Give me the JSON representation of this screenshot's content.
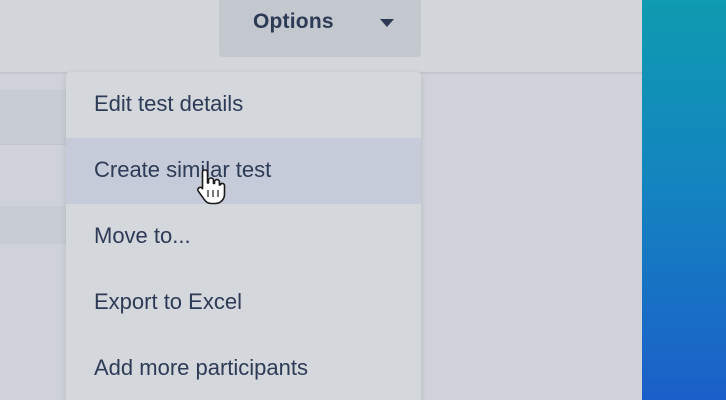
{
  "options_button": {
    "label": "Options",
    "icon": "caret-down-icon"
  },
  "menu": {
    "items": [
      {
        "label": "Edit test details",
        "hovered": false
      },
      {
        "label": "Create similar test",
        "hovered": true
      },
      {
        "label": "Move to...",
        "hovered": false
      },
      {
        "label": "Export to Excel",
        "hovered": false
      },
      {
        "label": "Add more participants",
        "hovered": false
      }
    ]
  },
  "colors": {
    "text": "#2d3b56",
    "menu_bg": "#d4d7dc",
    "hover_bg": "#c5cbd8",
    "button_bg": "#c3c7ce",
    "gradient_top": "#0f9bb0",
    "gradient_bottom": "#1b5fc9"
  },
  "cursor": {
    "icon": "hand-pointer-icon"
  }
}
